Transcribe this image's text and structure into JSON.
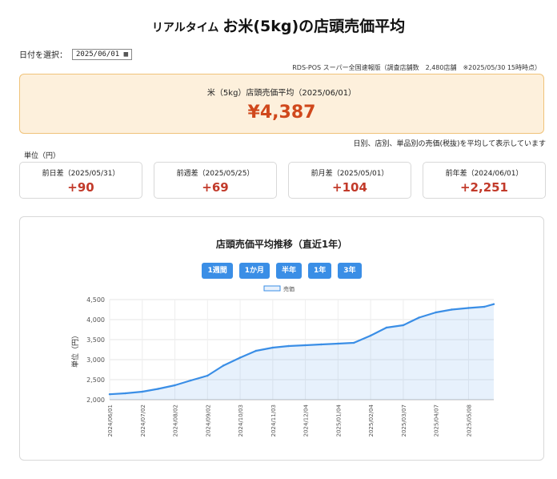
{
  "header": {
    "title_prefix": "リアルタイム ",
    "title_main": "お米(5kg)の店頭売価平均"
  },
  "date_select": {
    "label": "日付を選択：",
    "value": "2025/06/01"
  },
  "source_note": "RDS-POS スーパー全国速報版（調査店舗数　2,480店舗　※2025/05/30 15時時点）",
  "average": {
    "label": "米（5kg）店頭売価平均（2025/06/01）",
    "value": "¥4,387"
  },
  "calc_note": "日別、店別、単品別の売価(税抜)を平均して表示しています",
  "unit_label": "単位（円）",
  "diffs": [
    {
      "label": "前日差（2025/05/31）",
      "value": "+90"
    },
    {
      "label": "前週差（2025/05/25）",
      "value": "+69"
    },
    {
      "label": "前月差（2025/05/01）",
      "value": "+104"
    },
    {
      "label": "前年差（2024/06/01）",
      "value": "+2,251"
    }
  ],
  "chart": {
    "title": "店頭売価平均推移（直近1年）",
    "range_buttons": [
      "1週間",
      "1か月",
      "半年",
      "1年",
      "3年"
    ],
    "accent_color": "#3a8ee6"
  },
  "chart_data": {
    "type": "area",
    "title": "店頭売価平均推移（直近1年）",
    "xlabel": "",
    "ylabel": "単位（円）",
    "ylim": [
      2000,
      4500
    ],
    "yticks": [
      2000,
      2500,
      3000,
      3500,
      4000,
      4500
    ],
    "ytick_labels": [
      "2,000",
      "2,500",
      "3,000",
      "3,500",
      "4,000",
      "4,500"
    ],
    "grid": true,
    "legend": "top-center",
    "xtick_labels": [
      "2024/06/01",
      "2024/07/02",
      "2024/08/02",
      "2024/09/02",
      "2024/10/03",
      "2024/11/03",
      "2024/12/04",
      "2025/01/04",
      "2025/02/04",
      "2025/03/07",
      "2025/04/07",
      "2025/05/08"
    ],
    "series": [
      {
        "name": "売価",
        "color": "#3a8ee6",
        "x": [
          "2024/06/01",
          "2024/06/16",
          "2024/07/02",
          "2024/07/17",
          "2024/08/02",
          "2024/08/17",
          "2024/09/02",
          "2024/09/17",
          "2024/10/03",
          "2024/10/18",
          "2024/11/03",
          "2024/11/18",
          "2024/12/04",
          "2024/12/19",
          "2025/01/04",
          "2025/01/19",
          "2025/02/04",
          "2025/02/19",
          "2025/03/07",
          "2025/03/22",
          "2025/04/07",
          "2025/04/22",
          "2025/05/08",
          "2025/05/23",
          "2025/06/01"
        ],
        "y": [
          2136,
          2160,
          2200,
          2270,
          2360,
          2480,
          2600,
          2850,
          3050,
          3220,
          3300,
          3340,
          3360,
          3380,
          3400,
          3420,
          3600,
          3800,
          3860,
          4050,
          4180,
          4250,
          4290,
          4320,
          4387
        ]
      }
    ]
  }
}
